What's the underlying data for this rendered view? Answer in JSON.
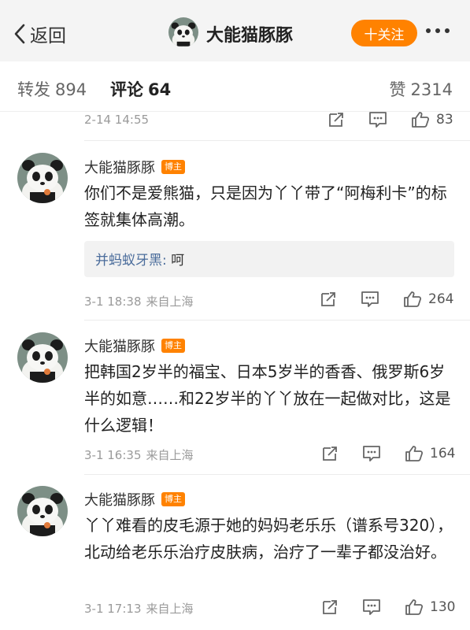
{
  "header": {
    "back_label": "返回",
    "user_name": "大能猫豚豚",
    "follow_label": "十关注"
  },
  "tabs": {
    "repost_label": "转发",
    "repost_count": "894",
    "comment_label": "评论",
    "comment_count": "64",
    "like_label": "赞",
    "like_count": "2314"
  },
  "top_partial": {
    "time": "2-14 14:55",
    "likes": "83"
  },
  "comments": [
    {
      "user": "大能猫豚豚",
      "badge": "博主",
      "text": "你们不是爱熊猫，只是因为丫丫带了“阿梅利卡”的标签就集体高潮。",
      "reply_user": "并蚂蚁牙黑",
      "reply_sep": ":",
      "reply_text": "呵",
      "time": "3-1 18:38",
      "source": "来自上海",
      "likes": "264"
    },
    {
      "user": "大能猫豚豚",
      "badge": "博主",
      "text": "把韩国2岁半的福宝、日本5岁半的香香、俄罗斯6岁半的如意……和22岁半的丫丫放在一起做对比，这是什么逻辑！",
      "time": "3-1 16:35",
      "source": "来自上海",
      "likes": "164"
    },
    {
      "user": "大能猫豚豚",
      "badge": "博主",
      "text": "丫丫难看的皮毛源于她的妈妈老乐乐（谱系号320），北动给老乐乐治疗皮肤病，治疗了一辈子都没治好。",
      "time": "3-1 17:13",
      "source": "来自上海",
      "likes": "130"
    }
  ],
  "icons": {
    "back": "chevron-left-icon",
    "share": "share-icon",
    "comment": "comment-icon",
    "like": "thumbs-up-icon",
    "more": "more-icon"
  },
  "colors": {
    "accent": "#ff8200",
    "link": "#4a6c9b",
    "meta": "#9a9a9a"
  }
}
